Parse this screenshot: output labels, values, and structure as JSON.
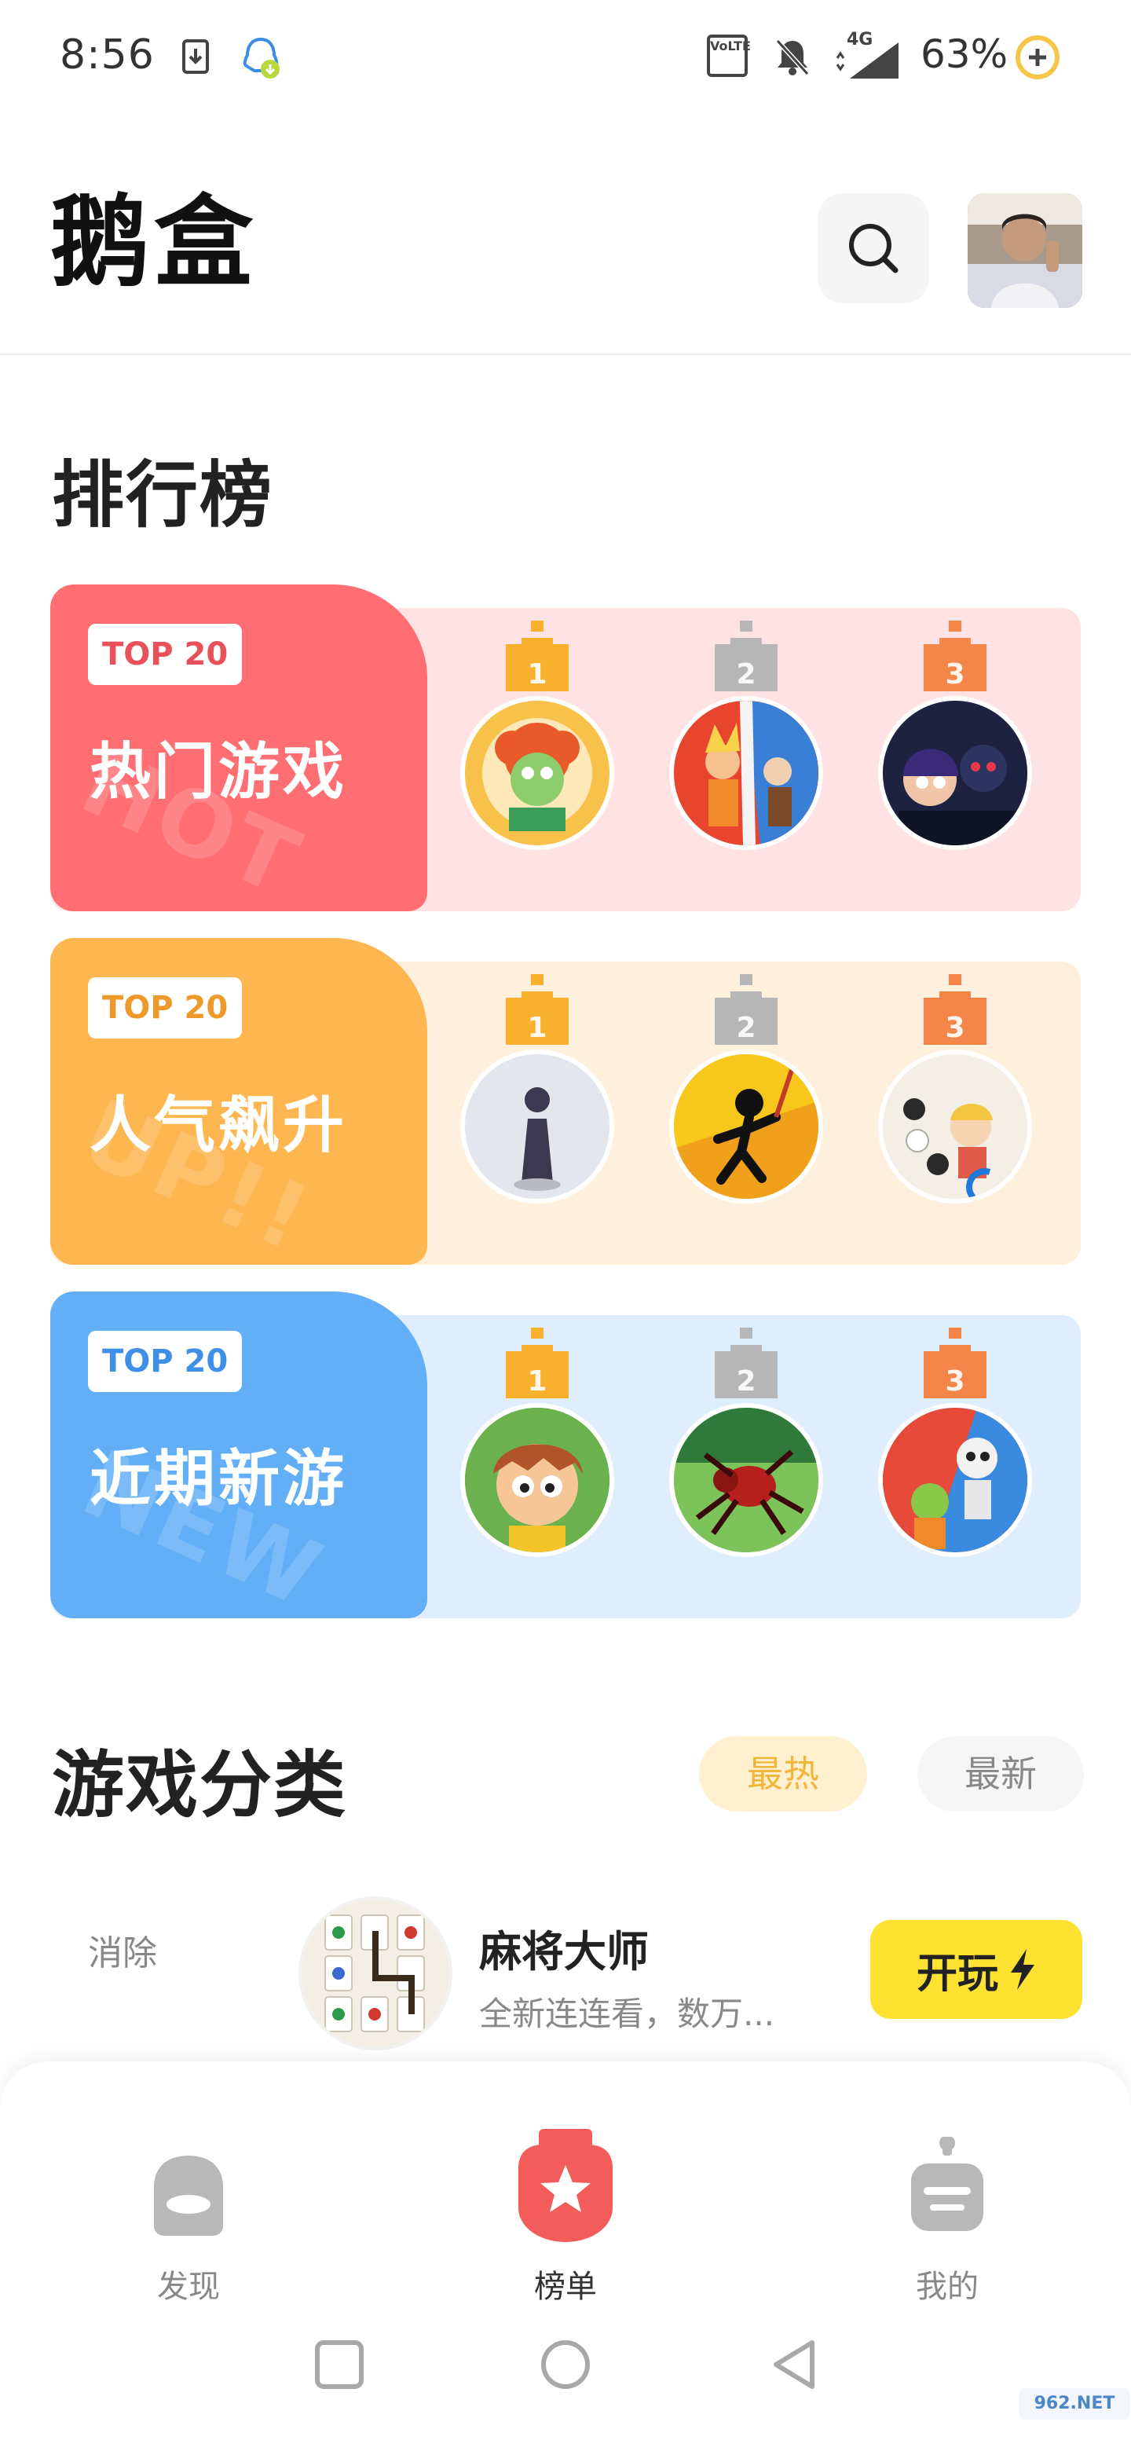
{
  "status_bar": {
    "time": "8:56",
    "battery": "63%",
    "network": "4G",
    "volte": "VoLTE"
  },
  "header": {
    "app_name": "鹅盒"
  },
  "ranking": {
    "title": "排行榜",
    "cards": [
      {
        "badge": "TOP 20",
        "name": "热门游戏",
        "watermark": "HOT",
        "accent": "#f46168",
        "panel_bg": "#ff6e73",
        "card_bg": "#ffe3e4",
        "badge_color": "#e8505a"
      },
      {
        "badge": "TOP 20",
        "name": "人气飙升",
        "watermark": "UP!!",
        "accent": "#f9a93e",
        "panel_bg": "#fdb650",
        "card_bg": "#fff0de",
        "badge_color": "#ee9a2a"
      },
      {
        "badge": "TOP 20",
        "name": "近期新游",
        "watermark": "NEW",
        "accent": "#4d9df2",
        "panel_bg": "#62aef7",
        "card_bg": "#deeefd",
        "badge_color": "#3f8fe6"
      }
    ],
    "ranks": [
      "1",
      "2",
      "3"
    ],
    "crown_colors": [
      "#f9b02c",
      "#b6b6b6",
      "#f5864a"
    ]
  },
  "categories": {
    "title": "游戏分类",
    "tabs": [
      {
        "label": "最热",
        "active": true
      },
      {
        "label": "最新",
        "active": false
      }
    ]
  },
  "game_item": {
    "category": "消除",
    "name": "麻将大师",
    "description": "全新连连看，数万...",
    "play_label": "开玩"
  },
  "bottom_nav": [
    {
      "label": "发现",
      "icon": "discover-icon",
      "active": false
    },
    {
      "label": "榜单",
      "icon": "ranking-star-icon",
      "active": true
    },
    {
      "label": "我的",
      "icon": "robot-profile-icon",
      "active": false
    }
  ],
  "watermark": "962.NET",
  "colors": {
    "accent_yellow": "#fde232",
    "active_tab_bg": "#fff1cf",
    "active_tab_text": "#f2b53c",
    "nav_active": "#f45c5c"
  }
}
